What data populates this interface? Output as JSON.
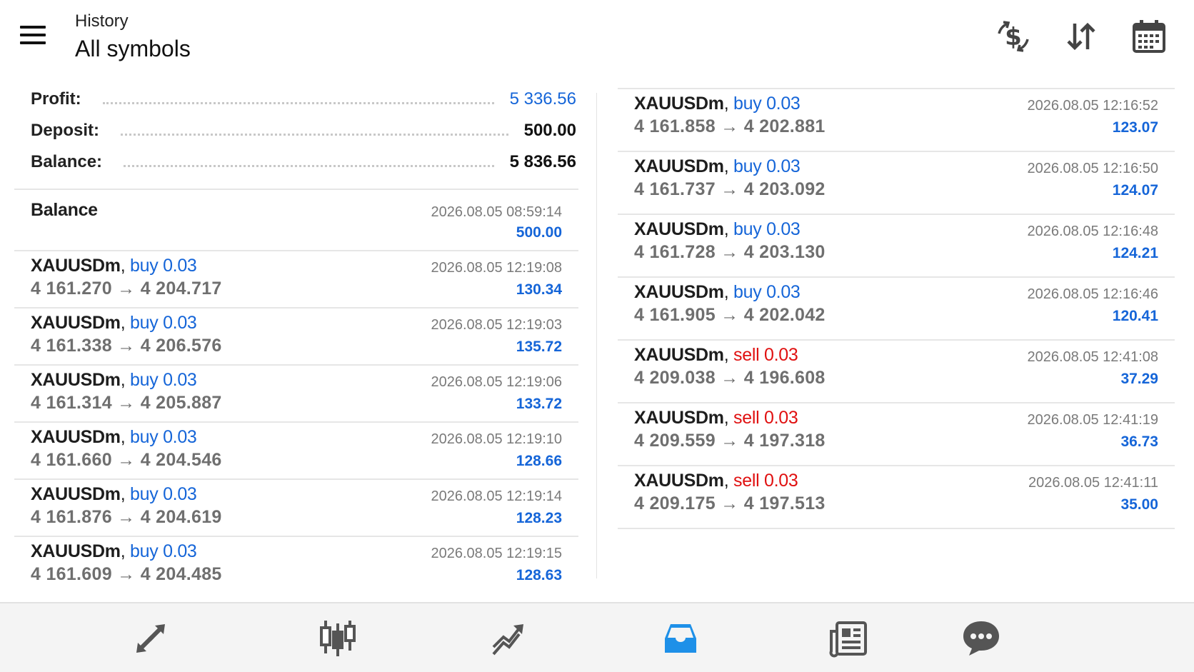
{
  "header": {
    "subtitle": "History",
    "title": "All symbols",
    "icons": [
      "menu-icon",
      "dollar-exchange-icon",
      "sort-icon",
      "calendar-icon"
    ]
  },
  "summary": {
    "profit_label": "Profit:",
    "profit_value": "5 336.56",
    "deposit_label": "Deposit:",
    "deposit_value": "500.00",
    "balance_label": "Balance:",
    "balance_value": "5 836.56"
  },
  "balance_entry": {
    "label": "Balance",
    "time": "2026.08.05 08:59:14",
    "amount": "500.00"
  },
  "deals_left": [
    {
      "symbol": "XAUUSDm",
      "sep": ",",
      "side": "buy 0.03",
      "prices": "4 161.270 → 4 204.717",
      "time": "2026.08.05 12:19:08",
      "profit": "130.34"
    },
    {
      "symbol": "XAUUSDm",
      "sep": ",",
      "side": "buy 0.03",
      "prices": "4 161.338 → 4 206.576",
      "time": "2026.08.05 12:19:03",
      "profit": "135.72"
    },
    {
      "symbol": "XAUUSDm",
      "sep": ",",
      "side": "buy 0.03",
      "prices": "4 161.314 → 4 205.887",
      "time": "2026.08.05 12:19:06",
      "profit": "133.72"
    },
    {
      "symbol": "XAUUSDm",
      "sep": ",",
      "side": "buy 0.03",
      "prices": "4 161.660 → 4 204.546",
      "time": "2026.08.05 12:19:10",
      "profit": "128.66"
    },
    {
      "symbol": "XAUUSDm",
      "sep": ",",
      "side": "buy 0.03",
      "prices": "4 161.876 → 4 204.619",
      "time": "2026.08.05 12:19:14",
      "profit": "128.23"
    },
    {
      "symbol": "XAUUSDm",
      "sep": ",",
      "side": "buy 0.03",
      "prices": "4 161.609 → 4 204.485",
      "time": "2026.08.05 12:19:15",
      "profit": "128.63"
    }
  ],
  "deals_right": [
    {
      "symbol": "XAUUSDm",
      "sep": ",",
      "side": "buy 0.03",
      "prices": "4 161.858 → 4 202.881",
      "time": "2026.08.05 12:16:52",
      "profit": "123.07"
    },
    {
      "symbol": "XAUUSDm",
      "sep": ",",
      "side": "buy 0.03",
      "prices": "4 161.737 → 4 203.092",
      "time": "2026.08.05 12:16:50",
      "profit": "124.07"
    },
    {
      "symbol": "XAUUSDm",
      "sep": ",",
      "side": "buy 0.03",
      "prices": "4 161.728 → 4 203.130",
      "time": "2026.08.05 12:16:48",
      "profit": "124.21"
    },
    {
      "symbol": "XAUUSDm",
      "sep": ",",
      "side": "buy 0.03",
      "prices": "4 161.905 → 4 202.042",
      "time": "2026.08.05 12:16:46",
      "profit": "120.41"
    },
    {
      "symbol": "XAUUSDm",
      "sep": ",",
      "side": "sell 0.03",
      "prices": "4 209.038 → 4 196.608",
      "time": "2026.08.05 12:41:08",
      "profit": "37.29"
    },
    {
      "symbol": "XAUUSDm",
      "sep": ",",
      "side": "sell 0.03",
      "prices": "4 209.559 → 4 197.318",
      "time": "2026.08.05 12:41:19",
      "profit": "36.73"
    },
    {
      "symbol": "XAUUSDm",
      "sep": ",",
      "side": "sell 0.03",
      "prices": "4 209.175 → 4 197.513",
      "time": "2026.08.05 12:41:11",
      "profit": "35.00"
    }
  ],
  "bottom_nav": {
    "items": [
      "quotes-icon",
      "chart-icon",
      "trade-icon",
      "history-icon",
      "news-icon",
      "chat-icon"
    ],
    "active": "history-icon"
  },
  "colors": {
    "accent_blue": "#1565d8",
    "sell_red": "#e01010",
    "nav_background": "#f4f4f4"
  }
}
